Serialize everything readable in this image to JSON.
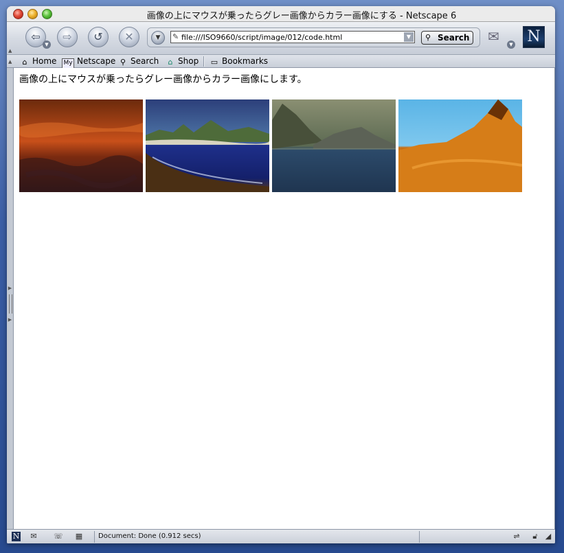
{
  "window": {
    "title": "画像の上にマウスが乗ったらグレー画像からカラー画像にする - Netscape 6"
  },
  "toolbar": {
    "back_icon": "back-arrow-icon",
    "forward_icon": "forward-arrow-icon",
    "reload_icon": "reload-icon",
    "stop_icon": "stop-icon",
    "url": "file:///ISO9660/script/image/012/code.html",
    "search_label": "Search",
    "logo_letter": "N"
  },
  "personal_toolbar": {
    "items": [
      {
        "label": "Home",
        "icon": "home-icon"
      },
      {
        "label": "Netscape",
        "icon": "my-netscape-icon",
        "badge": "My"
      },
      {
        "label": "Search",
        "icon": "search-icon"
      },
      {
        "label": "Shop",
        "icon": "shop-icon"
      },
      {
        "label": "Bookmarks",
        "icon": "bookmarks-folder-icon"
      }
    ]
  },
  "page": {
    "text": "画像の上にマウスが乗ったらグレー画像からカラー画像にします。",
    "images": [
      {
        "name": "sunset-landscape",
        "colors": [
          "#6b2a0c",
          "#c8501a",
          "#7a2a10",
          "#3a1a1a"
        ]
      },
      {
        "name": "coastal-bay",
        "colors": [
          "#2c3f7a",
          "#1e2f8a",
          "#14206a",
          "#5a3a1c"
        ]
      },
      {
        "name": "mountain-lake",
        "colors": [
          "#8a8f72",
          "#5c6a52",
          "#2c4a6a",
          "#1f3550"
        ]
      },
      {
        "name": "desert-peak",
        "colors": [
          "#5ab4e6",
          "#c76f16",
          "#e38f1c",
          "#a8520c"
        ]
      }
    ]
  },
  "status": {
    "text": "Document: Done (0.912 secs)"
  }
}
